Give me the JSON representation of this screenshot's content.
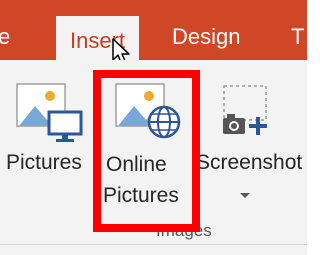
{
  "tabs": [
    {
      "label": "e",
      "active": false
    },
    {
      "label": "Insert",
      "active": true
    },
    {
      "label": "Design",
      "active": false
    },
    {
      "label": "T",
      "active": false
    }
  ],
  "ribbon": {
    "buttons": [
      {
        "label": "Pictures",
        "icon": "picture-monitor-icon"
      },
      {
        "label_line1": "Online",
        "label_line2": "Pictures",
        "icon": "picture-globe-icon"
      },
      {
        "label": "Screenshot",
        "icon": "camera-plus-icon",
        "has_dropdown": true
      }
    ],
    "group_label": "Images"
  },
  "colors": {
    "tab_bar": "#d04727",
    "highlight": "#ff0000",
    "ribbon_bg": "#f3f3f3",
    "icon_blue": "#2b579a",
    "icon_orange": "#f0a830"
  }
}
